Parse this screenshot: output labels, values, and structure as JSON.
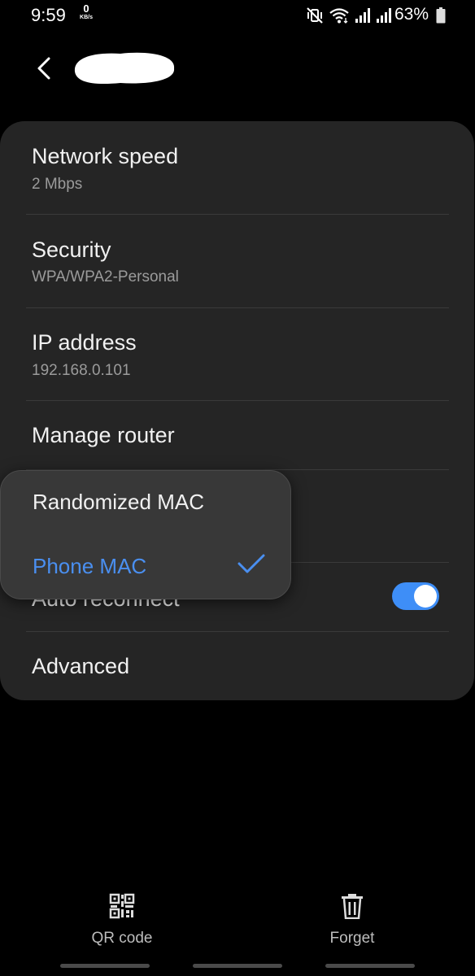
{
  "status_bar": {
    "time": "9:59",
    "net_speed_value": "0",
    "net_speed_unit": "KB/s",
    "battery_percent": "63%"
  },
  "header": {
    "back_icon": "chevron-left-icon",
    "network_name_redacted": true
  },
  "settings": {
    "network_speed": {
      "title": "Network speed",
      "value": "2 Mbps"
    },
    "security": {
      "title": "Security",
      "value": "WPA/WPA2-Personal"
    },
    "ip_address": {
      "title": "IP address",
      "value": "192.168.0.101"
    },
    "manage_router": {
      "title": "Manage router"
    },
    "auto_reconnect": {
      "title": "Auto reconnect",
      "enabled": true
    },
    "advanced": {
      "title": "Advanced"
    }
  },
  "mac_popup": {
    "options": [
      "Randomized MAC",
      "Phone MAC"
    ],
    "selected": "Phone MAC"
  },
  "bottom_bar": {
    "qr_code_label": "QR code",
    "forget_label": "Forget"
  },
  "colors": {
    "accent": "#3e8ef7",
    "selected_text": "#4a8ff0",
    "card_background": "#252525",
    "popup_background": "#383838"
  }
}
